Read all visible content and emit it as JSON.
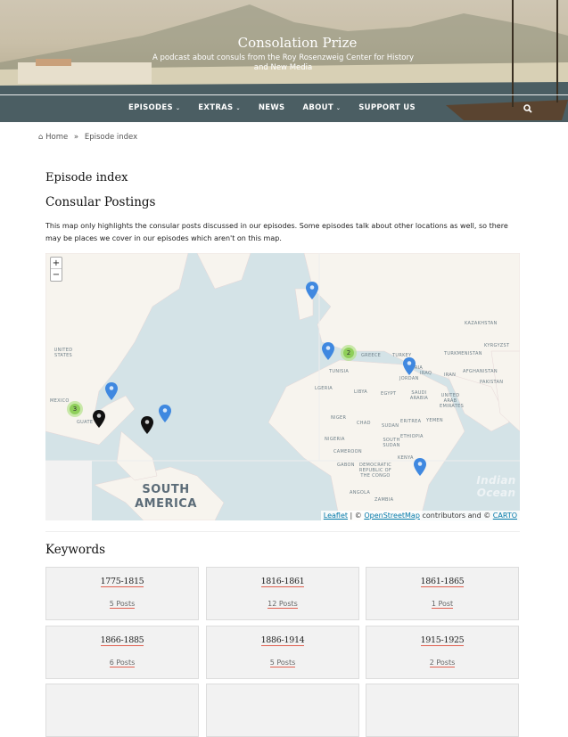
{
  "header": {
    "site_title": "Consolation Prize",
    "tagline": "A podcast about consuls from the Roy Rosenzweig Center for History and New Media"
  },
  "nav": {
    "items": [
      {
        "label": "EPISODES",
        "has_dropdown": true
      },
      {
        "label": "EXTRAS",
        "has_dropdown": true
      },
      {
        "label": "NEWS",
        "has_dropdown": false
      },
      {
        "label": "ABOUT",
        "has_dropdown": true
      },
      {
        "label": "SUPPORT US",
        "has_dropdown": false
      }
    ],
    "search_icon": "search-icon"
  },
  "breadcrumb": {
    "home": "Home",
    "separator": "»",
    "current": "Episode index"
  },
  "page": {
    "title": "Episode index",
    "section_title": "Consular Postings",
    "intro": "This map only highlights the consular posts discussed in our episodes. Some episodes talk about other locations as well, so there may be places we cover in our episodes which aren't on this map."
  },
  "map": {
    "zoom_in": "+",
    "zoom_out": "−",
    "labels": {
      "us": "UNITED STATES",
      "mexico": "MEXICO",
      "guate": "GUATE",
      "kazakhstan": "KAZAKHSTAN",
      "turkmenistan": "TURKMENISTAN",
      "kyrgyz": "KYRGYZST",
      "greece": "GREECE",
      "turkey": "TURKEY",
      "syria": "SYRIA",
      "iraq": "IRAQ",
      "iran": "IRAN",
      "afghanistan": "AFGHANISTAN",
      "pakistan": "PAKISTAN",
      "tunisia": "TUNISIA",
      "jordan": "JORDAN",
      "algeria": "LGERIA",
      "libya": "LIBYA",
      "egypt": "EGYPT",
      "saudi": "SAUDI ARABIA",
      "uae": "UNITED ARAB EMIRATES",
      "niger": "NIGER",
      "chad": "CHAD",
      "sudan": "SUDAN",
      "eritrea": "ERITREA",
      "yemen": "YEMEN",
      "nigeria": "NIGERIA",
      "south_sudan": "SOUTH SUDAN",
      "ethiopia": "ETHIOPIA",
      "cameroon": "CAMEROON",
      "kenya": "KENYA",
      "gabon": "GABON",
      "drc": "DEMOCRATIC REPUBLIC OF THE CONGO",
      "angola": "ANGOLA",
      "zambia": "ZAMBIA",
      "south_america": "SOUTH AMERICA",
      "indian_ocean": "Indian Ocean"
    },
    "clusters": [
      {
        "count": "3"
      },
      {
        "count": "2"
      }
    ],
    "markers": {
      "blue": 6,
      "black": 2
    },
    "attribution": {
      "leaflet": "Leaflet",
      "sep": " | © ",
      "osm": "OpenStreetMap",
      "mid": " contributors and © ",
      "carto": "CARTO"
    },
    "colors": {
      "ocean": "#d4e3e7",
      "land": "#f7f4ee",
      "marker_blue": "#3f88e0",
      "marker_black": "#111111",
      "cluster": "#8fcf5a"
    }
  },
  "keywords": {
    "title": "Keywords",
    "items": [
      {
        "label": "1775-1815",
        "count": "5 Posts"
      },
      {
        "label": "1816-1861",
        "count": "12 Posts"
      },
      {
        "label": "1861-1865",
        "count": "1 Post"
      },
      {
        "label": "1866-1885",
        "count": "6 Posts"
      },
      {
        "label": "1886-1914",
        "count": "5 Posts"
      },
      {
        "label": "1915-1925",
        "count": "2 Posts"
      }
    ]
  }
}
